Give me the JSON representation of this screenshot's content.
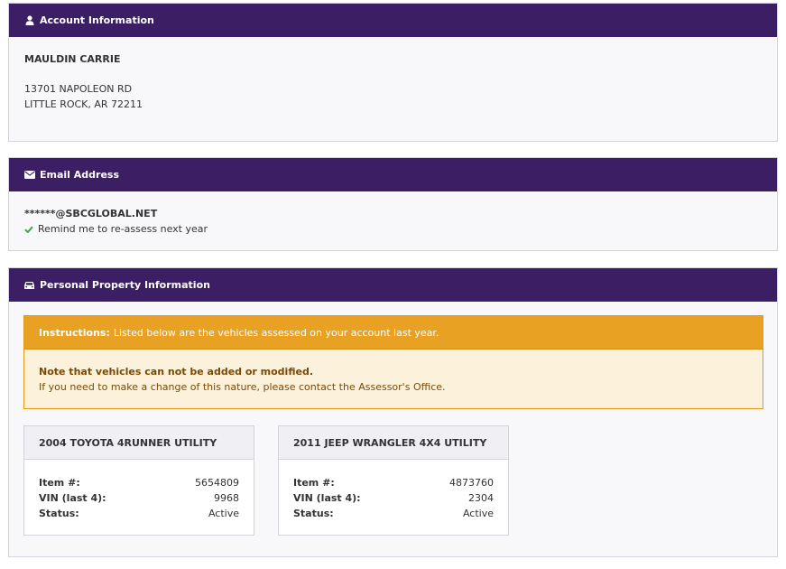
{
  "account": {
    "header": "Account Information",
    "icon": "user-icon",
    "name": "MAULDIN CARRIE",
    "address_line1": "13701 NAPOLEON RD",
    "address_line2": "LITTLE ROCK, AR 72211"
  },
  "email": {
    "header": "Email Address",
    "icon": "envelope-icon",
    "address": "******@SBCGLOBAL.NET",
    "remind": "Remind me to re-assess next year"
  },
  "property": {
    "header": "Personal Property Information",
    "icon": "car-icon",
    "instructions_label": "Instructions:",
    "instructions_text": "Listed below are the vehicles assessed on your account last year.",
    "note_title": "Note that vehicles can not be added or modified.",
    "note_text": "If you need to make a change of this nature, please contact the Assessor's Office.",
    "vehicles": [
      {
        "title": "2004 TOYOTA 4RUNNER UTILITY",
        "item_label": "Item #:",
        "item": "5654809",
        "vin_label": "VIN (last 4):",
        "vin": "9968",
        "status_label": "Status:",
        "status": "Active"
      },
      {
        "title": "2011 JEEP WRANGLER 4X4 UTILITY",
        "item_label": "Item #:",
        "item": "4873760",
        "vin_label": "VIN (last 4):",
        "vin": "2304",
        "status_label": "Status:",
        "status": "Active"
      }
    ]
  },
  "colors": {
    "header_purple": "#3b1e63",
    "warning_orange": "#e8a123",
    "check_green": "#3aa84a"
  }
}
